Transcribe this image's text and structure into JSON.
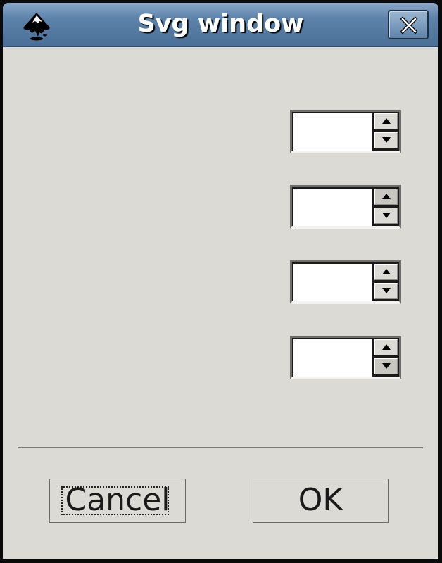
{
  "window": {
    "title": "Svg window",
    "icon": "inkscape-logo-icon",
    "close_icon": "close-icon"
  },
  "spin_fields": [
    {
      "value": ""
    },
    {
      "value": ""
    },
    {
      "value": ""
    },
    {
      "value": ""
    }
  ],
  "buttons": {
    "cancel_label": "Cancel",
    "ok_label": "OK"
  },
  "colors": {
    "titlebar": "#4a6f97",
    "dialog_bg": "#dcdad5"
  }
}
